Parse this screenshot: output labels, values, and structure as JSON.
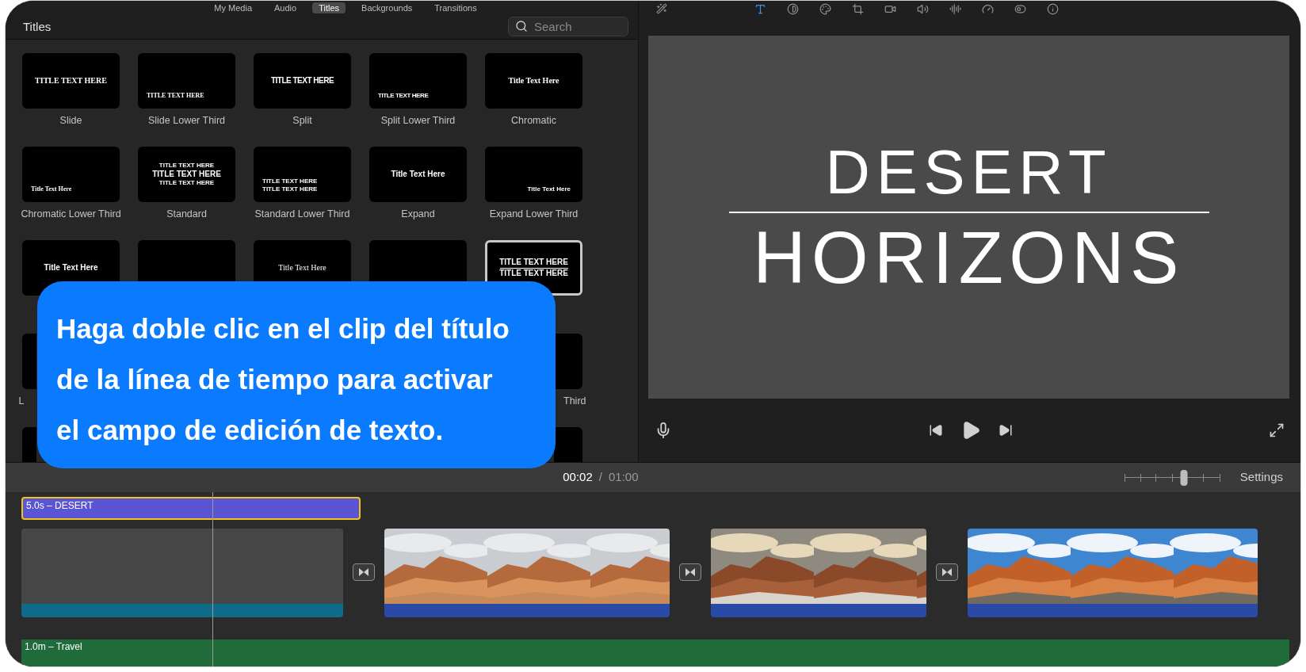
{
  "browser_tabs": [
    {
      "label": "My Media",
      "selected": false
    },
    {
      "label": "Audio",
      "selected": false
    },
    {
      "label": "Titles",
      "selected": true
    },
    {
      "label": "Backgrounds",
      "selected": false
    },
    {
      "label": "Transitions",
      "selected": false
    }
  ],
  "library": {
    "title": "Titles",
    "search": {
      "placeholder": "Search"
    },
    "rows": [
      [
        {
          "label": "Slide",
          "preview": [
            "TITLE TEXT HERE"
          ],
          "kind": "slide",
          "selected": false
        },
        {
          "label": "Slide Lower Third",
          "preview": [
            "TITLE TEXT HERE"
          ],
          "kind": "slide-lower",
          "selected": false
        },
        {
          "label": "Split",
          "preview": [
            "TITLE TEXT HERE"
          ],
          "kind": "split",
          "selected": false
        },
        {
          "label": "Split Lower Third",
          "preview": [
            "TITLE TEXT HERE"
          ],
          "kind": "split-lower",
          "selected": false
        },
        {
          "label": "Chromatic",
          "preview": [
            "Title Text Here"
          ],
          "kind": "chromatic",
          "selected": false
        }
      ],
      [
        {
          "label": "Chromatic Lower Third",
          "preview": [
            "Title Text Here"
          ],
          "kind": "chromatic-lower",
          "selected": false
        },
        {
          "label": "Standard",
          "preview": [
            "TITLE TEXT HERE",
            "TITLE TEXT HERE",
            "TITLE TEXT HERE"
          ],
          "kind": "standard",
          "selected": false
        },
        {
          "label": "Standard Lower Third",
          "preview": [
            "TITLE TEXT HERE",
            "TITLE TEXT HERE"
          ],
          "kind": "standard-lower",
          "selected": false
        },
        {
          "label": "Expand",
          "preview": [
            "Title Text Here"
          ],
          "kind": "expand",
          "selected": false
        },
        {
          "label": "Expand Lower Third",
          "preview": [
            "Title Text Here"
          ],
          "kind": "expand-lower",
          "selected": false
        }
      ],
      [
        {
          "preview": [
            "Title Text Here"
          ],
          "kind": "bold",
          "selected": false
        },
        {
          "kind": "blank",
          "selected": false
        },
        {
          "preview": [
            "Title Text Here"
          ],
          "kind": "serif",
          "selected": false
        },
        {
          "kind": "blank",
          "selected": false
        },
        {
          "preview": [
            "TITLE TEXT HERE",
            "TITLE TEXT HERE"
          ],
          "kind": "ruled",
          "selected": true
        }
      ],
      [
        {
          "label": "L",
          "kind": "blank",
          "selected": false
        },
        {
          "label": "Third",
          "kind": "blank",
          "selected": false
        }
      ],
      [
        {
          "kind": "blank",
          "selected": false
        },
        {
          "kind": "blank",
          "selected": false
        }
      ]
    ]
  },
  "viewer": {
    "title_lines": [
      "DESERT",
      "HORIZONS"
    ]
  },
  "timeline": {
    "current": "00:02",
    "separator": "/",
    "total": "01:00",
    "zoom": {
      "level": 0.63
    },
    "settings": "Settings",
    "title_clip": {
      "label": "5.0s – DESERT",
      "selected": true
    },
    "clips": [
      {
        "kind": "blank"
      },
      {
        "kind": "picture"
      },
      {
        "kind": "picture"
      },
      {
        "kind": "picture"
      }
    ],
    "audio_clip": {
      "label": "1.0m – Travel"
    }
  },
  "callout": {
    "text": "Haga doble clic en el clip del título\nde la línea de tiempo para activar\nel campo de edición de texto."
  }
}
